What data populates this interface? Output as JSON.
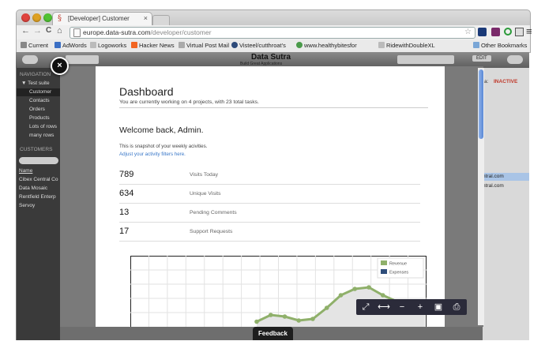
{
  "browser": {
    "tab_title": "[Developer] Customer",
    "tab_favicon": "§",
    "url_host": "europe.data-sutra.com",
    "url_path": "/developer/customer",
    "back_icon": "←",
    "forward_icon": "→",
    "reload_icon": "C",
    "home_icon": "⌂",
    "star_icon": "☆",
    "menu_icon": "≡",
    "bookmarks": [
      "Current",
      "AdWords",
      "Logoworks",
      "Hacker News",
      "Virtual Post Mail",
      "Visteel/cutthroat's",
      "www.healthybitesfor",
      "RidewithDoubleXL"
    ],
    "other_bookmarks": "Other Bookmarks"
  },
  "app": {
    "title": "Data Sutra",
    "subtitle": "Build Great Applications",
    "edit_label": "EDIT",
    "status_label": "a:",
    "status_value": "INACTIVE",
    "nav_header": "NAVIGATION",
    "nav_items": [
      "▼ Test suite",
      "Customer",
      "Contacts",
      "Orders",
      "Products",
      "Lots of rows",
      "many rows"
    ],
    "customers_header": "CUSTOMERS",
    "customers_col": "Name",
    "customers": [
      "Cibex Central Co",
      "Data Mosaic",
      "Rentfield Enterp",
      "Servoy"
    ],
    "right_rows": [
      "ntral.com",
      "ntral.com"
    ]
  },
  "dashboard": {
    "title": "Dashboard",
    "subtitle": "You are currently working on 4 projects, with 23 total tasks.",
    "welcome": "Welcome back, Admin.",
    "snapshot_note": "This is snapshot of your weekly acivities.",
    "adjust_link": "Adjust your activity filters here.",
    "stats": [
      {
        "value": "789",
        "label": "Visits Today"
      },
      {
        "value": "634",
        "label": "Unique Visits"
      },
      {
        "value": "13",
        "label": "Pending Comments"
      },
      {
        "value": "17",
        "label": "Support Requests"
      }
    ]
  },
  "chart_data": {
    "type": "line",
    "series": [
      {
        "name": "Revenue",
        "color": "#8fb06a",
        "values": [
          0.05,
          0.22,
          0.18,
          0.08,
          0.12,
          0.4,
          0.72,
          0.88,
          0.92,
          0.72,
          0.56,
          0.4,
          0.52
        ]
      },
      {
        "name": "Expenses",
        "color": "#2e4d7a",
        "values": []
      }
    ],
    "grid": true,
    "legend": "top-right"
  },
  "overlay": {
    "close_label": "×",
    "toolbar_icons": [
      "fit-icon",
      "expand-icon",
      "zoom-out-icon",
      "zoom-in-icon",
      "save-icon",
      "print-icon"
    ],
    "toolbar_glyphs": [
      "⤢",
      "⟷",
      "−",
      "+",
      "▣",
      "⎙"
    ],
    "feedback_label": "Feedback"
  }
}
